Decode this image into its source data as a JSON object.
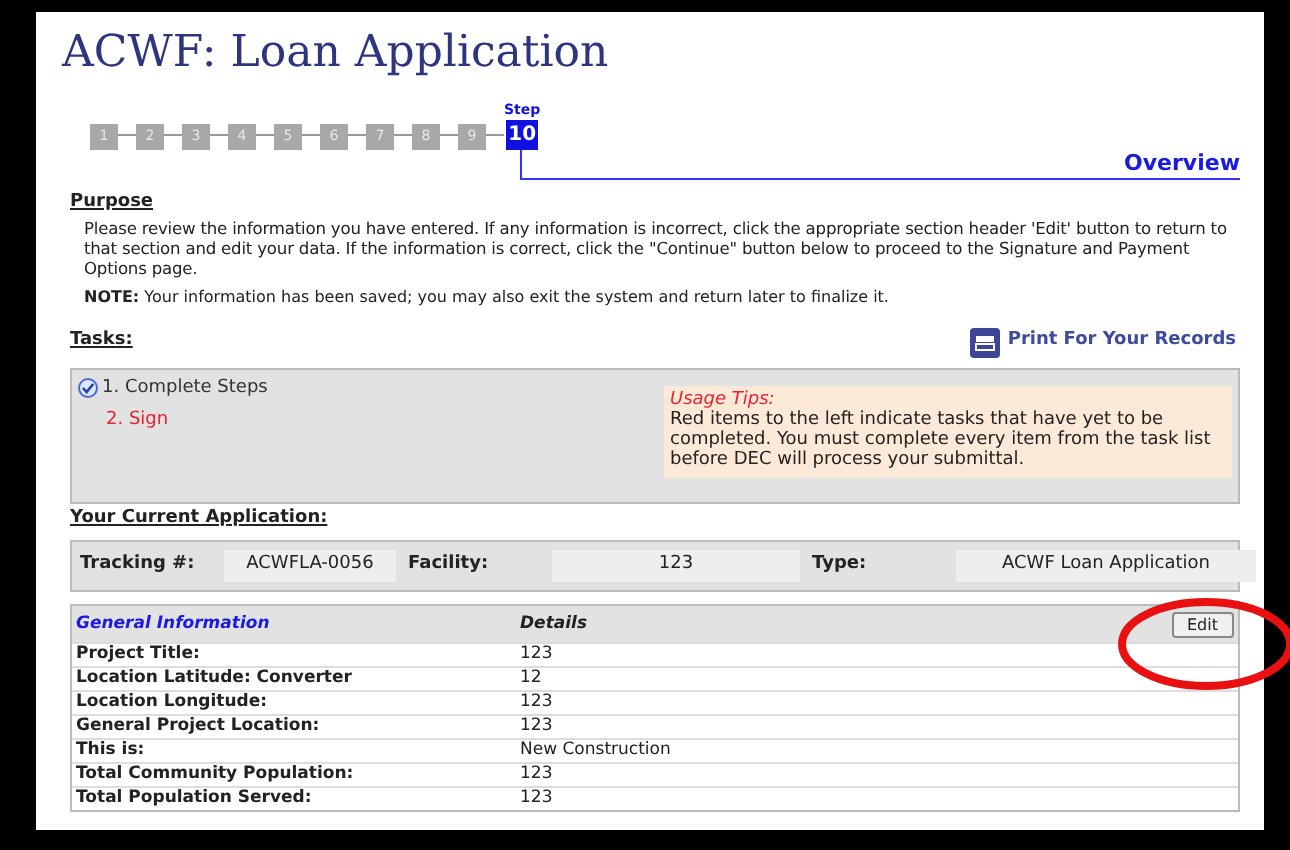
{
  "title": "ACWF: Loan Application",
  "steps": {
    "caption": "Step",
    "items": [
      {
        "label": "1",
        "selected": false
      },
      {
        "label": "2",
        "selected": false
      },
      {
        "label": "3",
        "selected": false
      },
      {
        "label": "4",
        "selected": false
      },
      {
        "label": "5",
        "selected": false
      },
      {
        "label": "6",
        "selected": false
      },
      {
        "label": "7",
        "selected": false
      },
      {
        "label": "8",
        "selected": false
      },
      {
        "label": "9",
        "selected": false
      },
      {
        "label": "10",
        "selected": true
      }
    ],
    "section": "Overview"
  },
  "purpose": {
    "heading": "Purpose",
    "text": "Please review the information you have entered. If any information is incorrect, click the appropriate section header 'Edit' button to return to that section and edit your data. If the information is correct, click the \"Continue\" button below to proceed to the Signature and Payment Options page.",
    "note": "**NOTE:** Your information has been saved; you may also exit the system and return later to finalize it."
  },
  "tasks": {
    "heading": "Tasks:",
    "print_link": "Print For Your Records",
    "items": [
      {
        "label": "1. Complete Steps",
        "done": true
      },
      {
        "label": "2. Sign",
        "done": false
      }
    ],
    "tips": {
      "title": "Usage Tips:",
      "text": "Red items to the left indicate tasks that have yet to be completed. You must complete every item from the task list before DEC will process your submittal."
    }
  },
  "application": {
    "heading": "Your Current Application:",
    "fields": [
      {
        "label": "Tracking #:",
        "value": "ACWFLA-0056"
      },
      {
        "label": "Facility:",
        "value": "123"
      },
      {
        "label": "Type:",
        "value": "ACWF Loan Application"
      }
    ]
  },
  "general_information": {
    "title": "General Information",
    "details_header": "Details",
    "edit_button": "Edit",
    "rows": [
      {
        "label": "Project Title:",
        "value": "123"
      },
      {
        "label": "Location Latitude: Converter",
        "value": "12"
      },
      {
        "label": "Location Longitude:",
        "value": "123"
      },
      {
        "label": "General Project Location:",
        "value": "123"
      },
      {
        "label": "This is:",
        "value": "New Construction"
      },
      {
        "label": "Total Community Population:",
        "value": "123"
      },
      {
        "label": "Total Population Served:",
        "value": "123"
      }
    ]
  }
}
